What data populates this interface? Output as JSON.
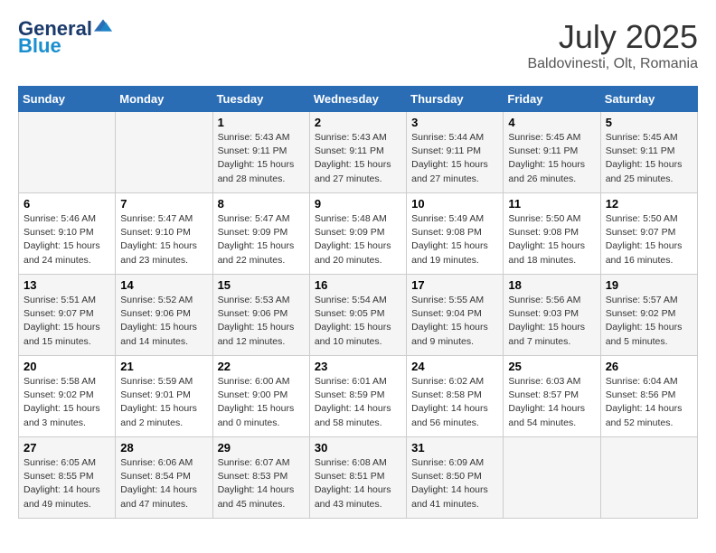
{
  "header": {
    "logo_line1": "General",
    "logo_line2": "Blue",
    "month_year": "July 2025",
    "location": "Baldovinesti, Olt, Romania"
  },
  "weekdays": [
    "Sunday",
    "Monday",
    "Tuesday",
    "Wednesday",
    "Thursday",
    "Friday",
    "Saturday"
  ],
  "weeks": [
    [
      {
        "day": "",
        "info": ""
      },
      {
        "day": "",
        "info": ""
      },
      {
        "day": "1",
        "info": "Sunrise: 5:43 AM\nSunset: 9:11 PM\nDaylight: 15 hours and 28 minutes."
      },
      {
        "day": "2",
        "info": "Sunrise: 5:43 AM\nSunset: 9:11 PM\nDaylight: 15 hours and 27 minutes."
      },
      {
        "day": "3",
        "info": "Sunrise: 5:44 AM\nSunset: 9:11 PM\nDaylight: 15 hours and 27 minutes."
      },
      {
        "day": "4",
        "info": "Sunrise: 5:45 AM\nSunset: 9:11 PM\nDaylight: 15 hours and 26 minutes."
      },
      {
        "day": "5",
        "info": "Sunrise: 5:45 AM\nSunset: 9:11 PM\nDaylight: 15 hours and 25 minutes."
      }
    ],
    [
      {
        "day": "6",
        "info": "Sunrise: 5:46 AM\nSunset: 9:10 PM\nDaylight: 15 hours and 24 minutes."
      },
      {
        "day": "7",
        "info": "Sunrise: 5:47 AM\nSunset: 9:10 PM\nDaylight: 15 hours and 23 minutes."
      },
      {
        "day": "8",
        "info": "Sunrise: 5:47 AM\nSunset: 9:09 PM\nDaylight: 15 hours and 22 minutes."
      },
      {
        "day": "9",
        "info": "Sunrise: 5:48 AM\nSunset: 9:09 PM\nDaylight: 15 hours and 20 minutes."
      },
      {
        "day": "10",
        "info": "Sunrise: 5:49 AM\nSunset: 9:08 PM\nDaylight: 15 hours and 19 minutes."
      },
      {
        "day": "11",
        "info": "Sunrise: 5:50 AM\nSunset: 9:08 PM\nDaylight: 15 hours and 18 minutes."
      },
      {
        "day": "12",
        "info": "Sunrise: 5:50 AM\nSunset: 9:07 PM\nDaylight: 15 hours and 16 minutes."
      }
    ],
    [
      {
        "day": "13",
        "info": "Sunrise: 5:51 AM\nSunset: 9:07 PM\nDaylight: 15 hours and 15 minutes."
      },
      {
        "day": "14",
        "info": "Sunrise: 5:52 AM\nSunset: 9:06 PM\nDaylight: 15 hours and 14 minutes."
      },
      {
        "day": "15",
        "info": "Sunrise: 5:53 AM\nSunset: 9:06 PM\nDaylight: 15 hours and 12 minutes."
      },
      {
        "day": "16",
        "info": "Sunrise: 5:54 AM\nSunset: 9:05 PM\nDaylight: 15 hours and 10 minutes."
      },
      {
        "day": "17",
        "info": "Sunrise: 5:55 AM\nSunset: 9:04 PM\nDaylight: 15 hours and 9 minutes."
      },
      {
        "day": "18",
        "info": "Sunrise: 5:56 AM\nSunset: 9:03 PM\nDaylight: 15 hours and 7 minutes."
      },
      {
        "day": "19",
        "info": "Sunrise: 5:57 AM\nSunset: 9:02 PM\nDaylight: 15 hours and 5 minutes."
      }
    ],
    [
      {
        "day": "20",
        "info": "Sunrise: 5:58 AM\nSunset: 9:02 PM\nDaylight: 15 hours and 3 minutes."
      },
      {
        "day": "21",
        "info": "Sunrise: 5:59 AM\nSunset: 9:01 PM\nDaylight: 15 hours and 2 minutes."
      },
      {
        "day": "22",
        "info": "Sunrise: 6:00 AM\nSunset: 9:00 PM\nDaylight: 15 hours and 0 minutes."
      },
      {
        "day": "23",
        "info": "Sunrise: 6:01 AM\nSunset: 8:59 PM\nDaylight: 14 hours and 58 minutes."
      },
      {
        "day": "24",
        "info": "Sunrise: 6:02 AM\nSunset: 8:58 PM\nDaylight: 14 hours and 56 minutes."
      },
      {
        "day": "25",
        "info": "Sunrise: 6:03 AM\nSunset: 8:57 PM\nDaylight: 14 hours and 54 minutes."
      },
      {
        "day": "26",
        "info": "Sunrise: 6:04 AM\nSunset: 8:56 PM\nDaylight: 14 hours and 52 minutes."
      }
    ],
    [
      {
        "day": "27",
        "info": "Sunrise: 6:05 AM\nSunset: 8:55 PM\nDaylight: 14 hours and 49 minutes."
      },
      {
        "day": "28",
        "info": "Sunrise: 6:06 AM\nSunset: 8:54 PM\nDaylight: 14 hours and 47 minutes."
      },
      {
        "day": "29",
        "info": "Sunrise: 6:07 AM\nSunset: 8:53 PM\nDaylight: 14 hours and 45 minutes."
      },
      {
        "day": "30",
        "info": "Sunrise: 6:08 AM\nSunset: 8:51 PM\nDaylight: 14 hours and 43 minutes."
      },
      {
        "day": "31",
        "info": "Sunrise: 6:09 AM\nSunset: 8:50 PM\nDaylight: 14 hours and 41 minutes."
      },
      {
        "day": "",
        "info": ""
      },
      {
        "day": "",
        "info": ""
      }
    ]
  ]
}
